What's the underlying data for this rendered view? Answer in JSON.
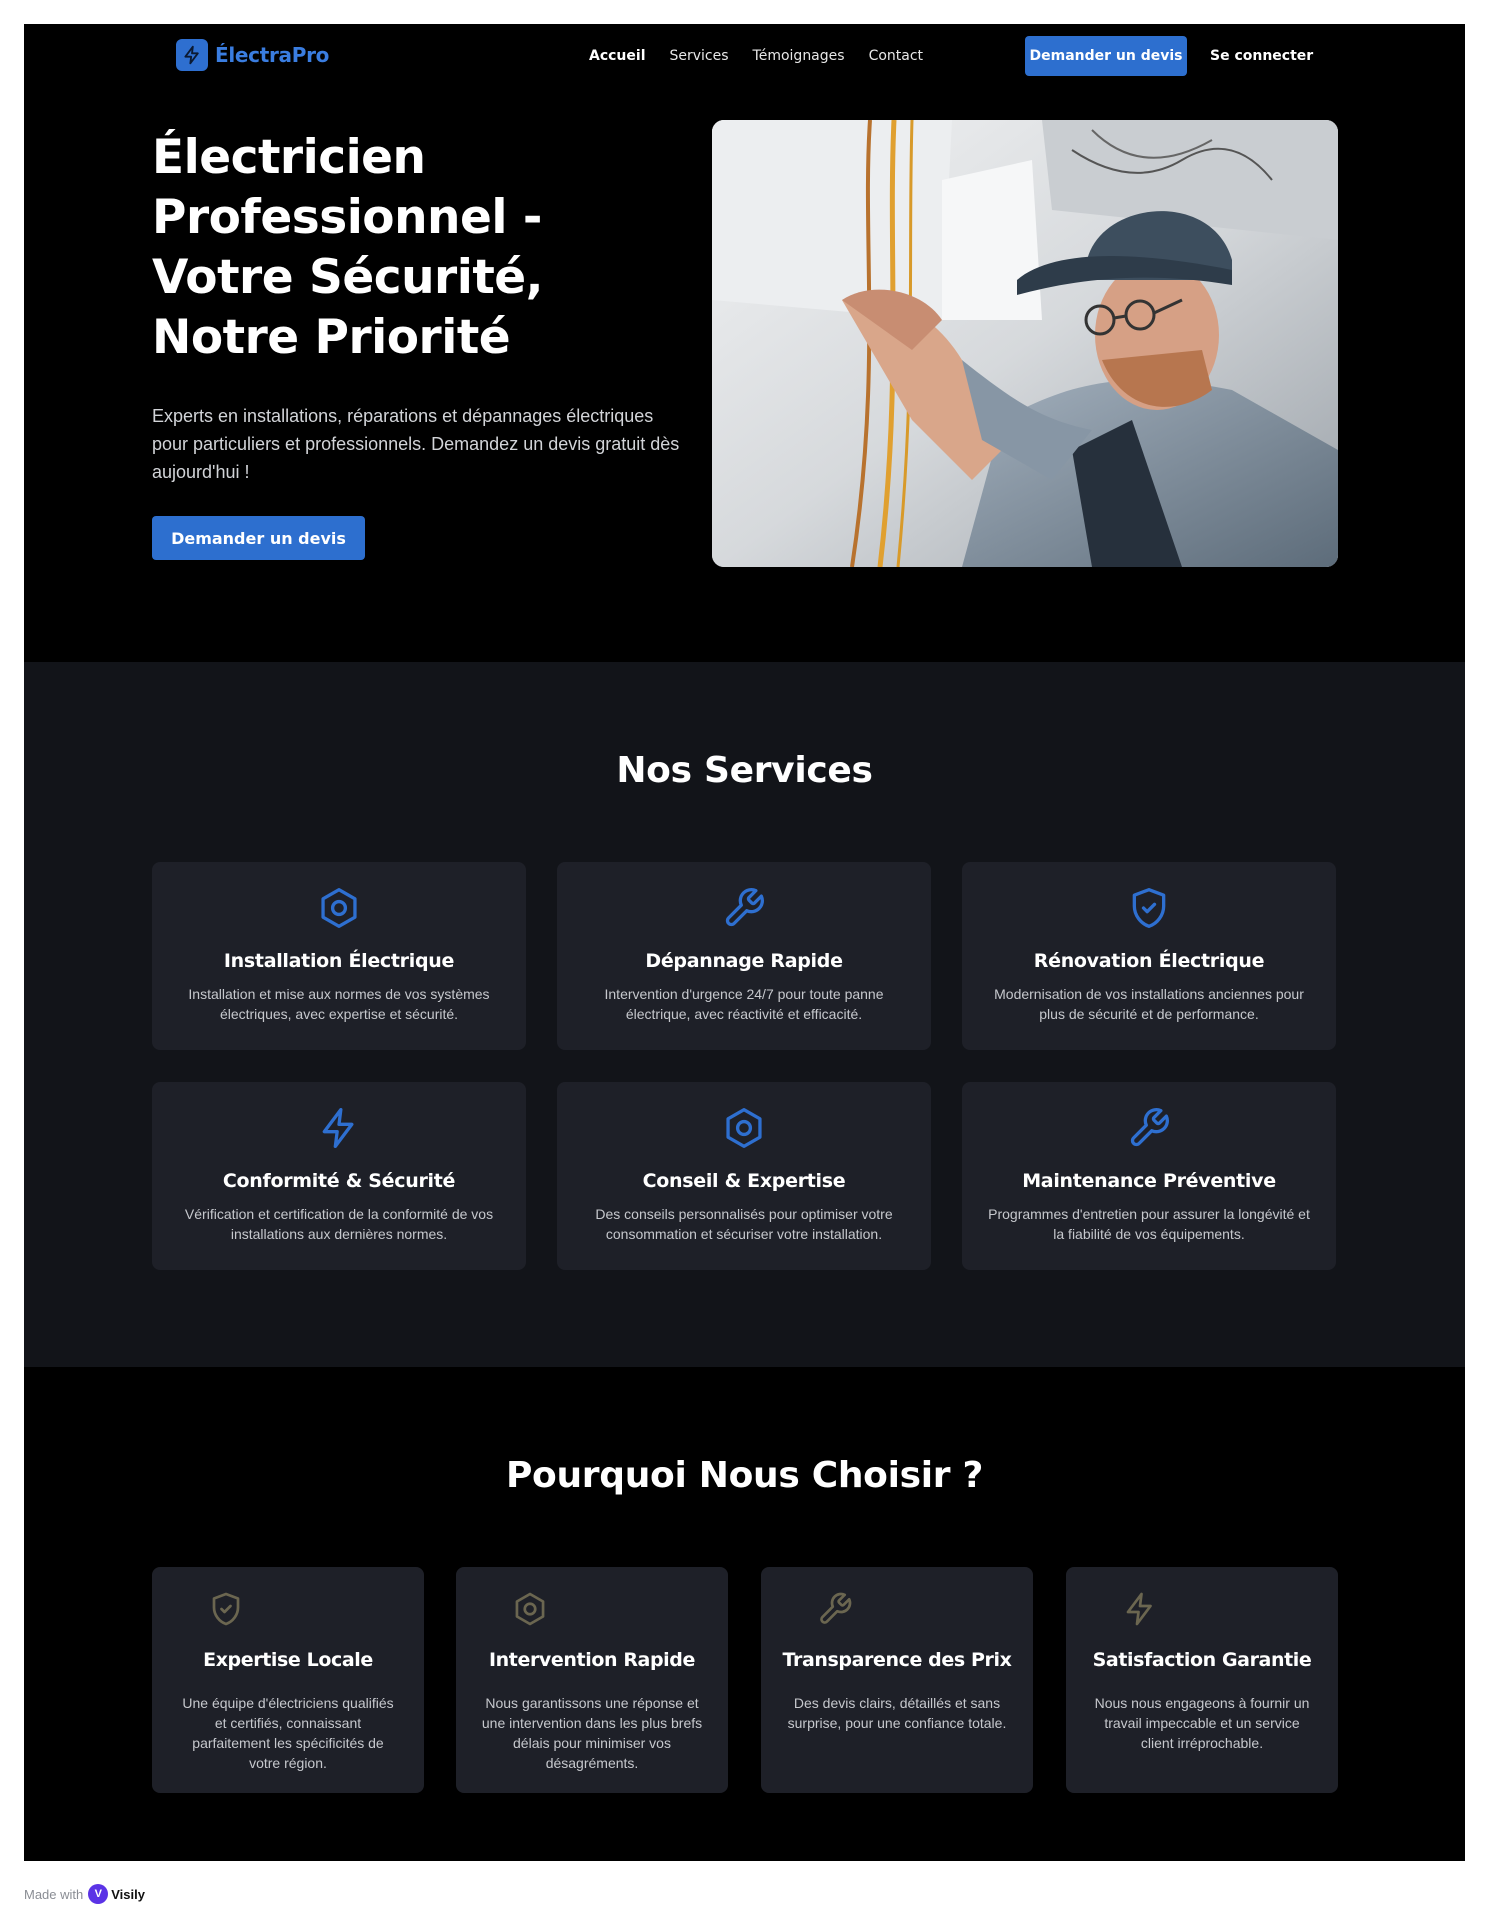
{
  "nav": {
    "brand": "ÉlectraPro",
    "links": [
      "Accueil",
      "Services",
      "Témoignages",
      "Contact"
    ],
    "cta": "Demander un devis",
    "signin": "Se connecter"
  },
  "hero": {
    "title": "Électricien Professionnel - Votre Sécurité, Notre Priorité",
    "subtitle": "Experts en installations, réparations et dépannages électriques pour particuliers et professionnels. Demandez un devis gratuit dès aujourd'hui !",
    "cta": "Demander un devis"
  },
  "services": {
    "title": "Nos Services",
    "items": [
      {
        "icon": "settings-hexagon-icon",
        "title": "Installation Électrique",
        "desc": "Installation et mise aux normes de vos systèmes électriques, avec expertise et sécurité."
      },
      {
        "icon": "wrench-icon",
        "title": "Dépannage Rapide",
        "desc": "Intervention d'urgence 24/7 pour toute panne électrique, avec réactivité et efficacité."
      },
      {
        "icon": "shield-check-icon",
        "title": "Rénovation Électrique",
        "desc": "Modernisation de vos installations anciennes pour plus de sécurité et de performance."
      },
      {
        "icon": "lightning-icon",
        "title": "Conformité & Sécurité",
        "desc": "Vérification et certification de la conformité de vos installations aux dernières normes."
      },
      {
        "icon": "settings-hexagon-icon",
        "title": "Conseil & Expertise",
        "desc": "Des conseils personnalisés pour optimiser votre consommation et sécuriser votre installation."
      },
      {
        "icon": "wrench-icon",
        "title": "Maintenance Préventive",
        "desc": "Programmes d'entretien pour assurer la longévité et la fiabilité de vos équipements."
      }
    ]
  },
  "why": {
    "title": "Pourquoi Nous Choisir ?",
    "items": [
      {
        "icon": "shield-check-icon",
        "title": "Expertise Locale",
        "desc": "Une équipe d'électriciens qualifiés et certifiés, connaissant parfaitement les spécificités de votre région."
      },
      {
        "icon": "settings-hexagon-icon",
        "title": "Intervention Rapide",
        "desc": "Nous garantissons une réponse et une intervention dans les plus brefs délais pour minimiser vos désagréments."
      },
      {
        "icon": "wrench-icon",
        "title": "Transparence des Prix",
        "desc": "Des devis clairs, détaillés et sans surprise, pour une confiance totale."
      },
      {
        "icon": "lightning-icon",
        "title": "Satisfaction Garantie",
        "desc": "Nous nous engageons à fournir un travail impeccable et un service client irréprochable."
      }
    ]
  },
  "footer": {
    "made_with": "Made with",
    "brand": "Visily"
  },
  "colors": {
    "accent": "#2d6fcf",
    "icon_blue": "#2e6fd0",
    "icon_muted": "#6b6650",
    "dark_section": "#121419",
    "card": "#1e2028"
  }
}
